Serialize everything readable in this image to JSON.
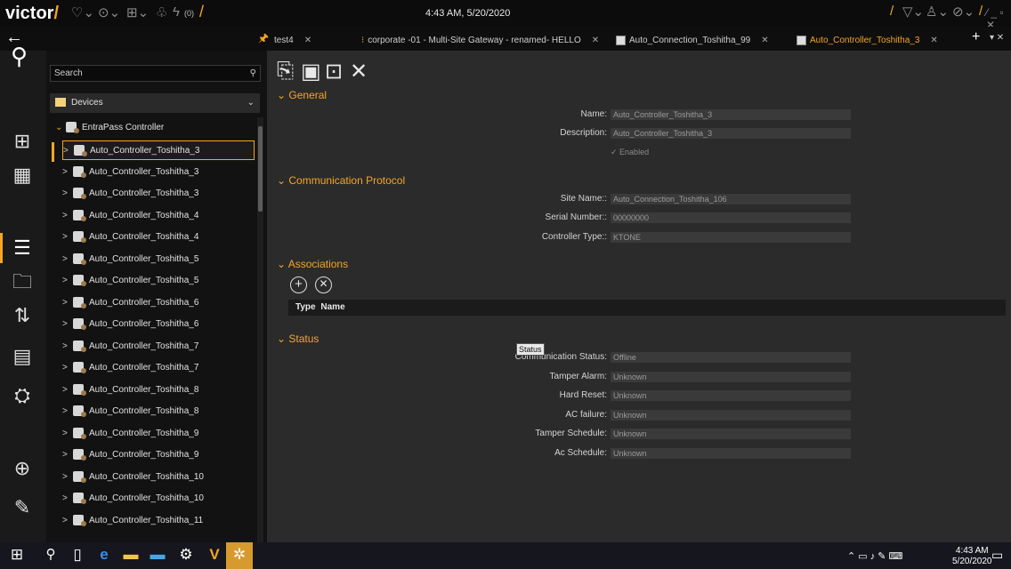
{
  "topbar": {
    "logo": "victor",
    "logo_slash": "/",
    "notification_count": "(0)",
    "datetime": "4:43 AM, 5/20/2020"
  },
  "tabs": [
    {
      "label": "test4",
      "active": false
    },
    {
      "label": "corporate -01 - Multi-Site Gateway - renamed- HELLO",
      "active": false
    },
    {
      "label": "Auto_Connection_Toshitha_99",
      "active": false
    },
    {
      "label": "Auto_Controller_Toshitha_3",
      "active": true
    }
  ],
  "sidebar": {
    "search_placeholder": "Search",
    "root": "Devices",
    "controller": "EntraPass Controller",
    "items": [
      "Auto_Controller_Toshitha_3",
      "Auto_Controller_Toshitha_3",
      "Auto_Controller_Toshitha_3",
      "Auto_Controller_Toshitha_4",
      "Auto_Controller_Toshitha_4",
      "Auto_Controller_Toshitha_5",
      "Auto_Controller_Toshitha_5",
      "Auto_Controller_Toshitha_6",
      "Auto_Controller_Toshitha_6",
      "Auto_Controller_Toshitha_7",
      "Auto_Controller_Toshitha_7",
      "Auto_Controller_Toshitha_8",
      "Auto_Controller_Toshitha_8",
      "Auto_Controller_Toshitha_9",
      "Auto_Controller_Toshitha_9",
      "Auto_Controller_Toshitha_10",
      "Auto_Controller_Toshitha_10",
      "Auto_Controller_Toshitha_11"
    ]
  },
  "general": {
    "title": "General",
    "name_label": "Name:",
    "name_value": "Auto_Controller_Toshitha_3",
    "description_label": "Description:",
    "description_value": "Auto_Controller_Toshitha_3",
    "enabled_label": "Enabled"
  },
  "communication": {
    "title": "Communication Protocol",
    "site_label": "Site Name::",
    "site_value": "Auto_Connection_Toshitha_106",
    "serial_label": "Serial Number::",
    "serial_value": "00000000",
    "type_label": "Controller Type::",
    "type_value": "KTONE"
  },
  "associations": {
    "title": "Associations",
    "col_type": "Type",
    "col_name": "Name"
  },
  "status": {
    "title": "Status",
    "tooltip": "Status",
    "fields": [
      {
        "label": "Communication Status:",
        "value": "Offline"
      },
      {
        "label": "Tamper Alarm:",
        "value": "Unknown"
      },
      {
        "label": "Hard Reset:",
        "value": "Unknown"
      },
      {
        "label": "AC failure:",
        "value": "Unknown"
      },
      {
        "label": "Tamper Schedule:",
        "value": "Unknown"
      },
      {
        "label": "Ac Schedule:",
        "value": "Unknown"
      }
    ]
  },
  "taskbar": {
    "time": "4:43 AM",
    "date": "5/20/2020"
  },
  "colors": {
    "accent": "#f5a623",
    "background": "#2b2b2b"
  }
}
